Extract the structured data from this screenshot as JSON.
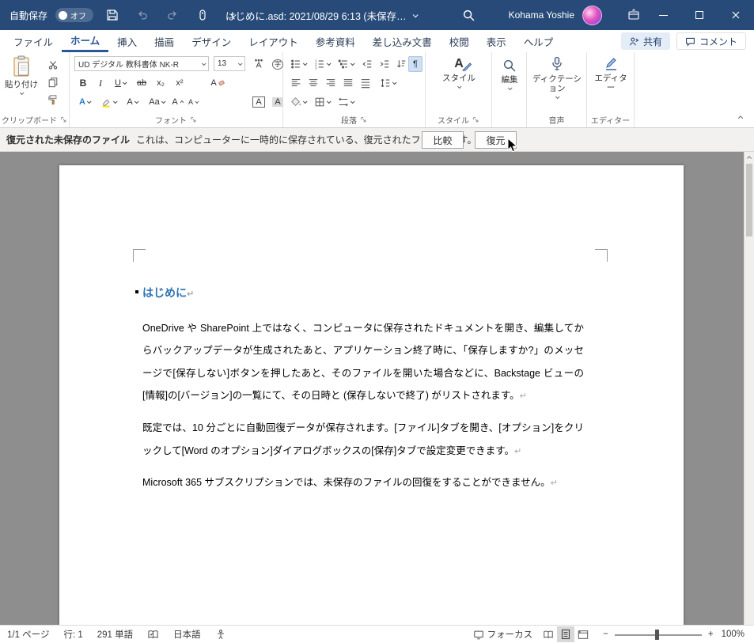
{
  "titlebar": {
    "autosave_label": "自動保存",
    "autosave_state": "オフ",
    "title": "はじめに.asd: 2021/08/29 6:13 (未保存…",
    "user_name": "Kohama Yoshie"
  },
  "ribbon": {
    "tabs": [
      "ファイル",
      "ホーム",
      "挿入",
      "描画",
      "デザイン",
      "レイアウト",
      "参考資料",
      "差し込み文書",
      "校閲",
      "表示",
      "ヘルプ"
    ],
    "share": "共有",
    "comments": "コメント",
    "paste": "貼り付け",
    "font_name": "UD デジタル 教科書体 NK-R",
    "font_size": "13",
    "styles_label": "スタイル",
    "editing_label": "編集",
    "dictation_label": "ディクテーション",
    "editor_label": "エディター",
    "group_labels": {
      "clipboard": "クリップボード",
      "font": "フォント",
      "paragraph": "段落",
      "styles": "スタイル",
      "voice": "音声",
      "editor": "エディター"
    },
    "glyphs": {
      "bold": "B",
      "italic": "I",
      "underline": "U",
      "strike": "ab",
      "subscript": "x₂",
      "superscript": "x²",
      "clear": "A",
      "effects": "A",
      "fontcolor": "A",
      "case": "Aa",
      "grow": "A",
      "shrink": "A",
      "enclose": "字",
      "charborder": "A",
      "charshade": "A",
      "pilcrow": "¶"
    }
  },
  "business_bar": {
    "title": "復元された未保存のファイル",
    "message": "これは、コンピューターに一時的に保存されている、復元されたファイルです。",
    "compare": "比較",
    "restore": "復元"
  },
  "document": {
    "heading": "はじめに",
    "return_mark": "↵",
    "paragraphs": [
      "OneDrive や SharePoint 上ではなく、コンピュータに保存されたドキュメントを開き、編集してからバックアップデータが生成されたあと、アプリケーション終了時に、「保存しますか?」のメッセージで[保存しない]ボタンを押したあと、そのファイルを開いた場合などに、Backstage ビューの[情報]の[バージョン]の一覧にて、その日時と (保存しないで終了) がリストされます。",
      "既定では、10 分ごとに自動回復データが保存されます。[ファイル]タブを開き、[オプション]をクリックして[Word のオプション]ダイアログボックスの[保存]タブで設定変更できます。",
      "Microsoft 365 サブスクリプションでは、未保存のファイルの回復をすることができません。"
    ]
  },
  "status_bar": {
    "page": "1/1 ページ",
    "line": "行: 1",
    "words": "291 単語",
    "language": "日本語",
    "focus": "フォーカス",
    "zoom_out": "−",
    "zoom_in": "+",
    "zoom_level": "100%"
  }
}
